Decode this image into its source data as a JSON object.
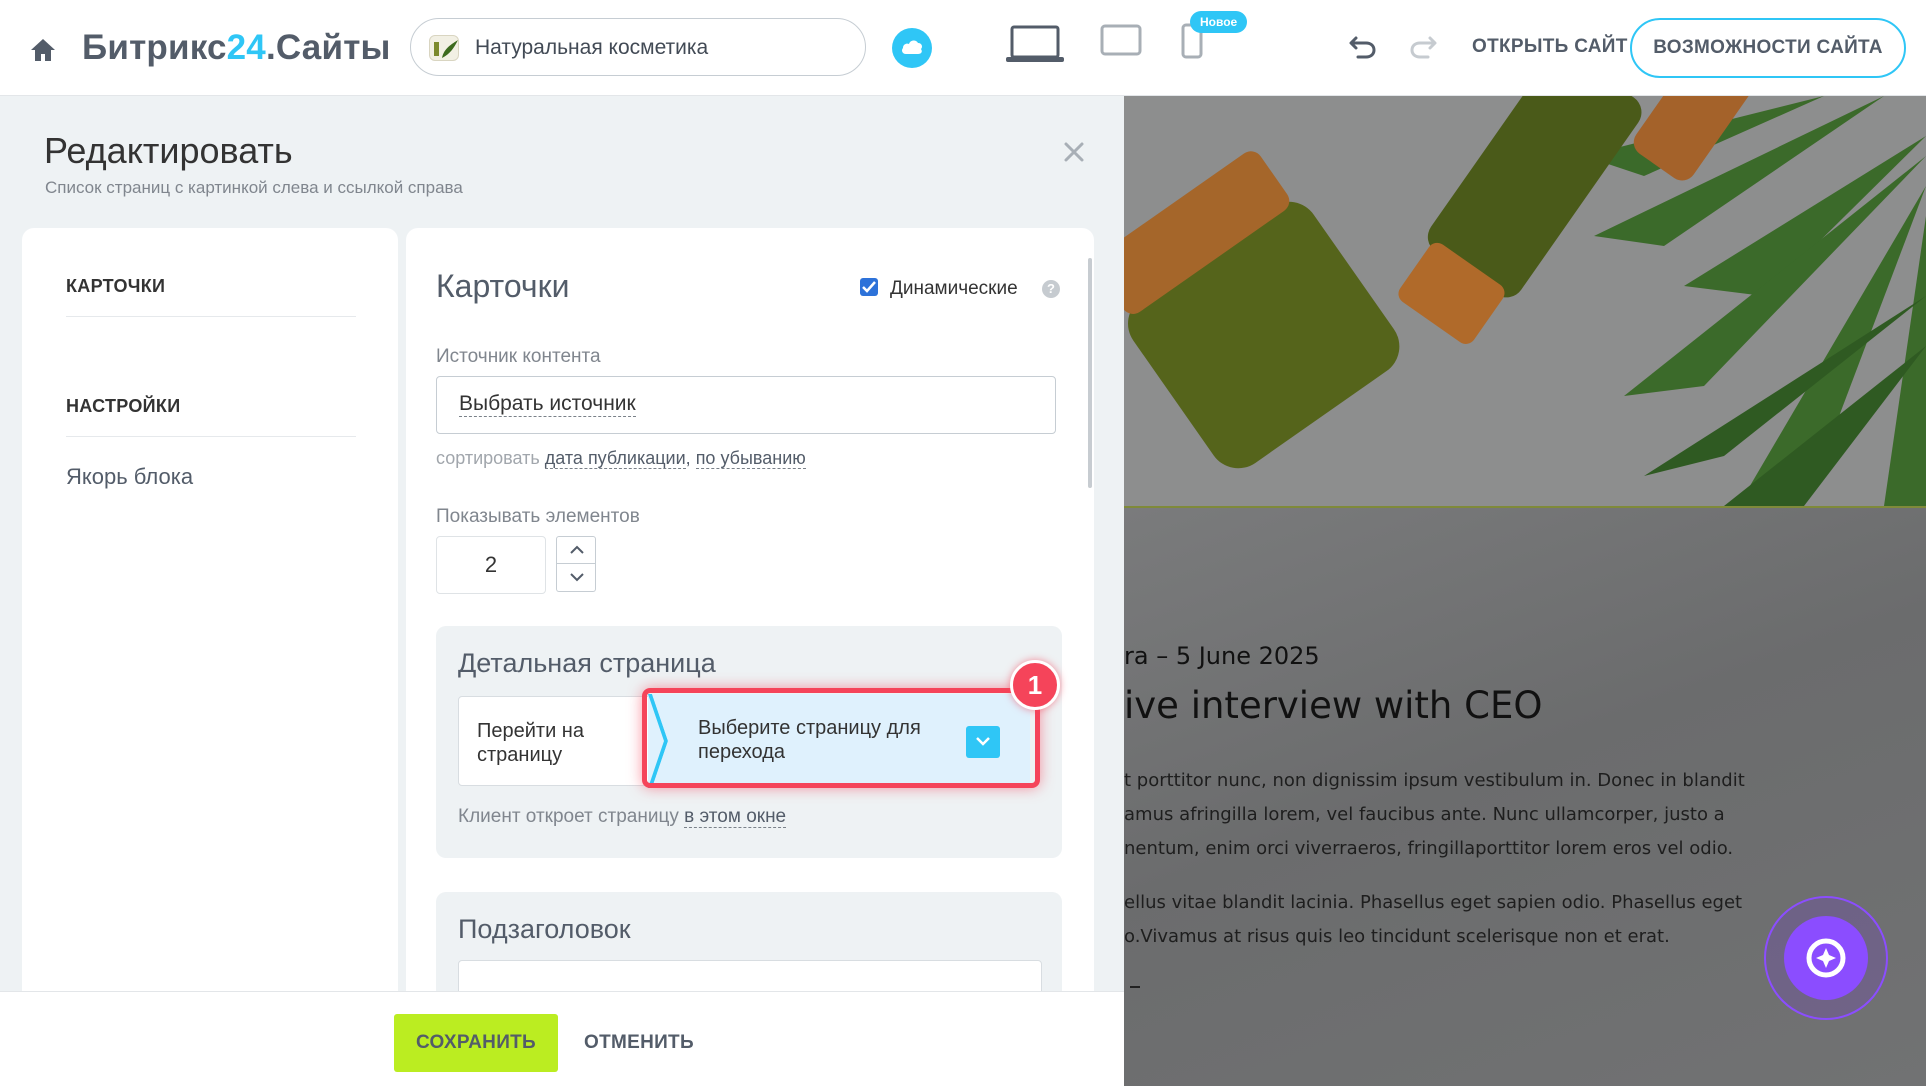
{
  "topbar": {
    "logo_main": "Битрикс",
    "logo_accent": "24",
    "logo_suffix": ".Сайты",
    "site_name": "Натуральная косметика",
    "new_badge": "Новое",
    "open_site": "ОТКРЫТЬ САЙТ",
    "features": "ВОЗМОЖНОСТИ САЙТА",
    "accent_color": "#2fc6f6",
    "icons": [
      "home-icon",
      "cloud-icon",
      "laptop-icon",
      "tablet-icon",
      "phone-icon",
      "undo-icon",
      "redo-icon"
    ]
  },
  "editor": {
    "title": "Редактировать",
    "subtitle": "Список страниц с картинкой слева и ссылкой справа",
    "nav": {
      "cards": "КАРТОЧКИ",
      "settings": "НАСТРОЙКИ",
      "anchor": "Якорь блока"
    },
    "cards": {
      "title": "Карточки",
      "dynamic_label": "Динамические",
      "dynamic_checked": true,
      "help": "?",
      "source_label": "Источник контента",
      "source_value": "Выбрать источник",
      "sort_prefix": "сортировать",
      "sort_field": "дата публикации",
      "sort_comma": ",",
      "sort_order": "по убыванию",
      "count_label": "Показывать элементов",
      "count_value": "2",
      "detail": {
        "title": "Детальная страница",
        "goto": "Перейти на страницу",
        "select": "Выберите страницу для перехода",
        "client_prefix": "Клиент откроет страницу",
        "client_link": "в этом окне",
        "step": "1"
      },
      "subheading_title": "Подзаголовок"
    },
    "save": "СОХРАНИТЬ",
    "cancel": "ОТМЕНИТЬ",
    "save_color": "#bbed21",
    "highlight_color": "#f5445a"
  },
  "preview": {
    "date": "ra  –  5 June 2025",
    "heading": "ive interview with CEO",
    "paragraph1": [
      "t porttitor nunc, non dignissim ipsum vestibulum in. Donec in blandit",
      "amus afringilla lorem, vel faucibus ante. Nunc ullamcorper, justo a",
      "nentum, enim orci viverraeros, fringillaporttitor lorem eros vel odio."
    ],
    "paragraph2": [
      "ellus vitae blandit lacinia. Phasellus eget sapien odio. Phasellus eget",
      "o.Vivamus at risus quis leo tincidunt scelerisque non et erat."
    ],
    "assistant_color": "#8b4dff"
  }
}
